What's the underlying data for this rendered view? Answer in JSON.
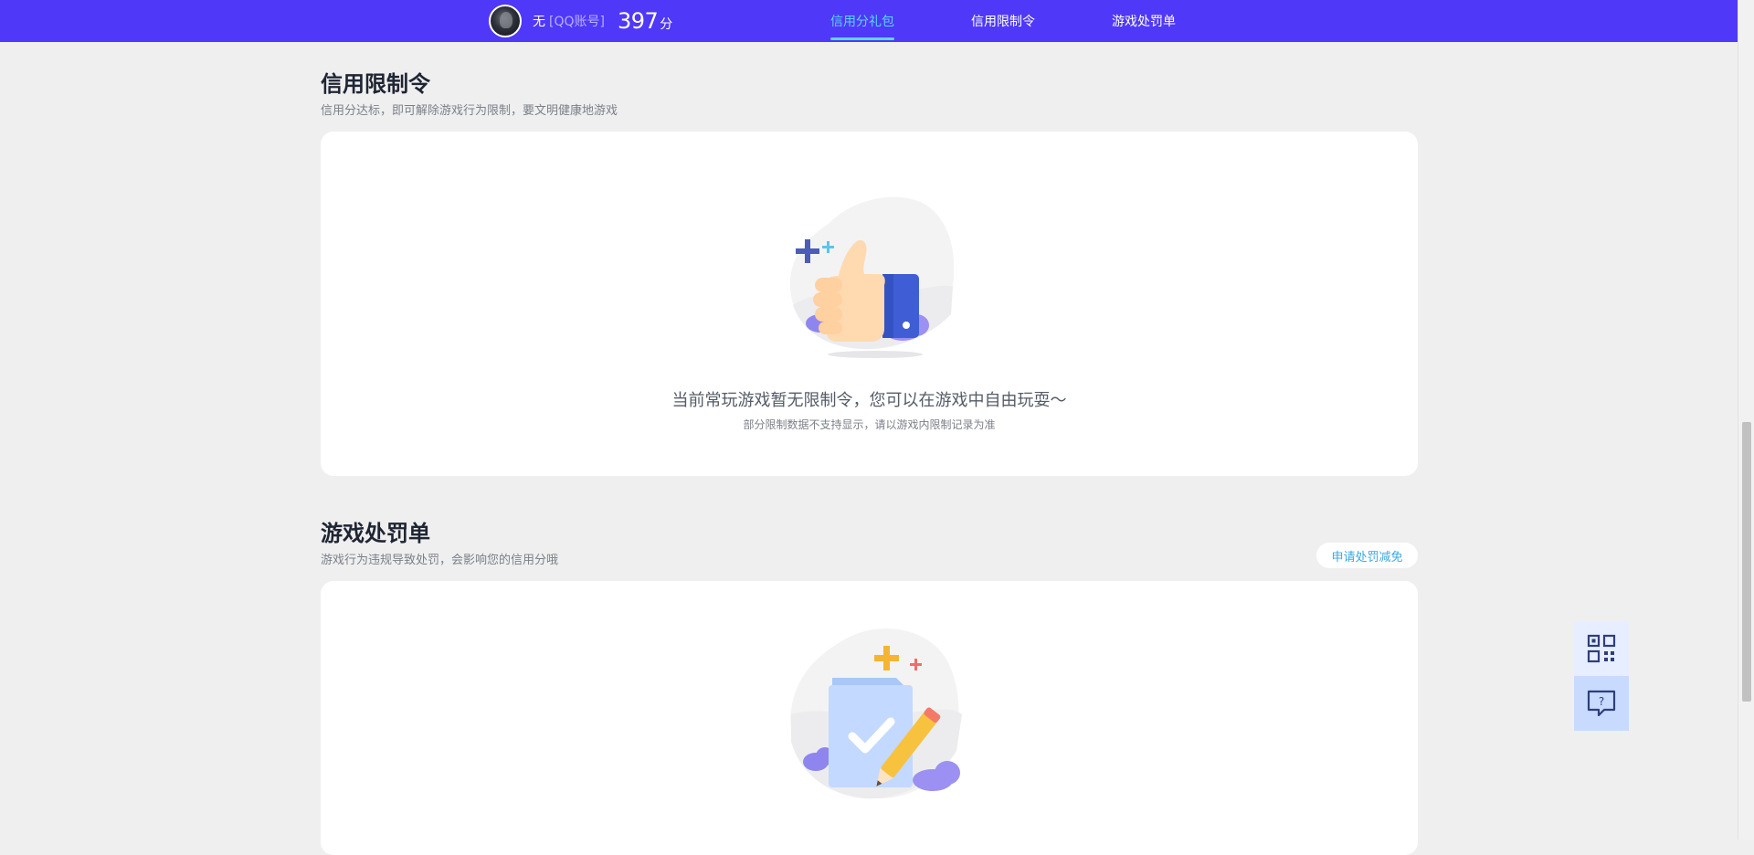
{
  "header": {
    "user_name": "无",
    "account_type": "[QQ账号]",
    "score": "397",
    "score_unit": "分",
    "nav": [
      {
        "label": "信用分礼包",
        "active": true
      },
      {
        "label": "信用限制令",
        "active": false
      },
      {
        "label": "游戏处罚单",
        "active": false
      }
    ]
  },
  "restriction": {
    "title": "信用限制令",
    "subtitle": "信用分达标，即可解除游戏行为限制，要文明健康地游戏",
    "empty_message": "当前常玩游戏暂无限制令，您可以在游戏中自由玩耍～",
    "empty_note": "部分限制数据不支持显示，请以游戏内限制记录为准",
    "illustration": "thumbs-up-icon"
  },
  "penalty": {
    "title": "游戏处罚单",
    "subtitle": "游戏行为违规导致处罚，会影响您的信用分哦",
    "appeal_label": "申请处罚减免",
    "illustration": "document-check-icon"
  },
  "floating": {
    "qr_icon": "qr-code-icon",
    "help_icon": "help-chat-icon"
  },
  "colors": {
    "brand": "#4f38f8",
    "active_tab": "#56d9f5",
    "link": "#3aa8e0"
  }
}
